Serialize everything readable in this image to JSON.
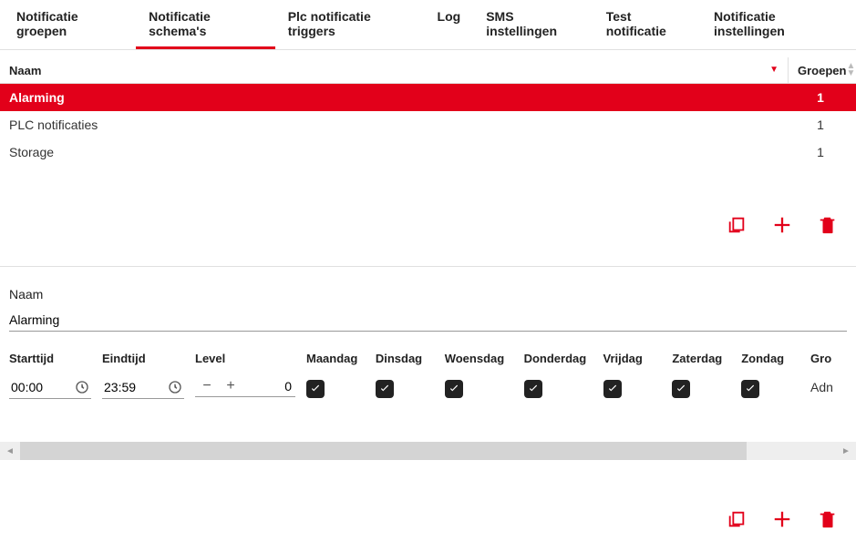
{
  "tabs": {
    "items": [
      {
        "label": "Notificatie groepen",
        "active": false
      },
      {
        "label": "Notificatie schema's",
        "active": true
      },
      {
        "label": "Plc notificatie triggers",
        "active": false
      },
      {
        "label": "Log",
        "active": false
      },
      {
        "label": "SMS instellingen",
        "active": false
      },
      {
        "label": "Test notificatie",
        "active": false
      },
      {
        "label": "Notificatie instellingen",
        "active": false
      }
    ]
  },
  "schema_table": {
    "headers": {
      "naam": "Naam",
      "groepen": "Groepen"
    },
    "rows": [
      {
        "naam": "Alarming",
        "groepen": "1",
        "selected": true
      },
      {
        "naam": "PLC notificaties",
        "groepen": "1",
        "selected": false
      },
      {
        "naam": "Storage",
        "groepen": "1",
        "selected": false
      }
    ]
  },
  "editor": {
    "naam_label": "Naam",
    "naam_value": "Alarming",
    "grid": {
      "starttijd": {
        "label": "Starttijd",
        "value": "00:00"
      },
      "eindtijd": {
        "label": "Eindtijd",
        "value": "23:59"
      },
      "level": {
        "label": "Level",
        "value": "0"
      },
      "days": {
        "maandag": {
          "label": "Maandag",
          "checked": true
        },
        "dinsdag": {
          "label": "Dinsdag",
          "checked": true
        },
        "woensdag": {
          "label": "Woensdag",
          "checked": true
        },
        "donderdag": {
          "label": "Donderdag",
          "checked": true
        },
        "vrijdag": {
          "label": "Vrijdag",
          "checked": true
        },
        "zaterdag": {
          "label": "Zaterdag",
          "checked": true
        },
        "zondag": {
          "label": "Zondag",
          "checked": true
        }
      },
      "overflow": {
        "groep_label": "Gro",
        "groep_value": "Adn"
      }
    }
  }
}
